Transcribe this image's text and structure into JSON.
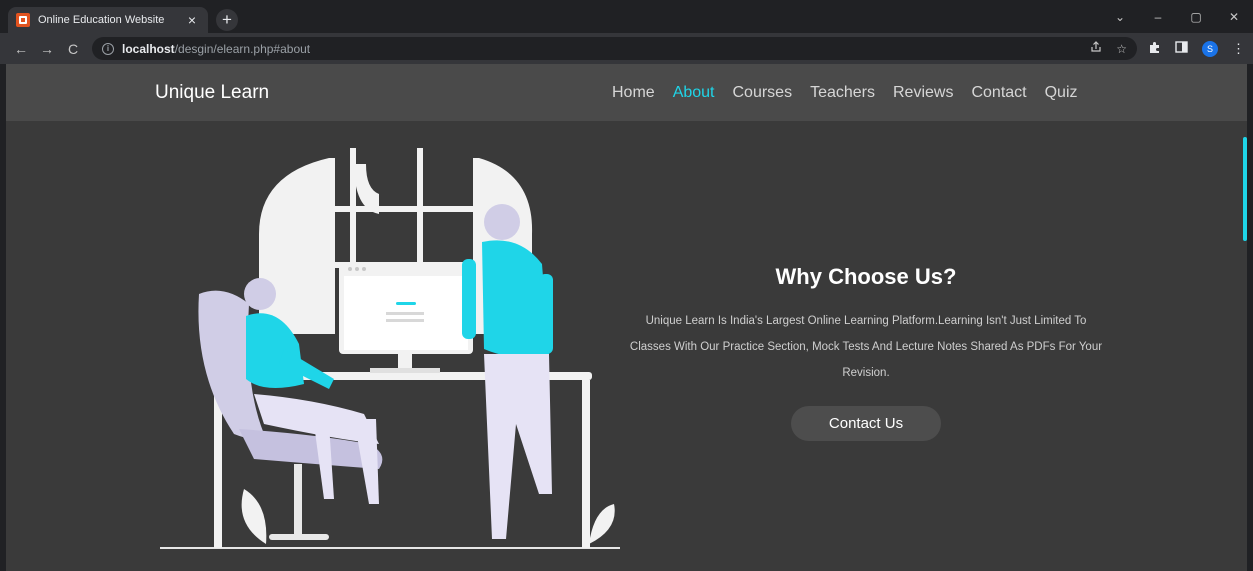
{
  "browser": {
    "tab_title": "Online Education Website",
    "tab_close": "×",
    "new_tab": "+",
    "url_host": "localhost",
    "url_path": "/desgin/elearn.php#about",
    "nav": {
      "back": "←",
      "forward": "→",
      "reload": "C"
    },
    "avatar_letter": "S",
    "window": {
      "chevron": "⌄",
      "minimize": "–",
      "maximize": "▢",
      "close": "✕"
    }
  },
  "site": {
    "logo": "Unique Learn",
    "nav": [
      {
        "label": "Home"
      },
      {
        "label": "About"
      },
      {
        "label": "Courses"
      },
      {
        "label": "Teachers"
      },
      {
        "label": "Reviews"
      },
      {
        "label": "Contact"
      },
      {
        "label": "Quiz"
      }
    ],
    "active_nav": "About",
    "about": {
      "title": "Why Choose Us?",
      "text": "Unique Learn Is India's Largest Online Learning Platform.Learning Isn't Just Limited To Classes With Our Practice Section, Mock Tests And Lecture Notes Shared As PDFs For Your Revision.",
      "button": "Contact Us"
    }
  },
  "colors": {
    "accent": "#1fd5e8",
    "header_bg": "#4a4a4a",
    "page_bg": "#3a3a3a"
  },
  "icons": [
    "tab-favicon-icon",
    "info-icon",
    "share-icon",
    "star-icon",
    "puzzle-icon",
    "sidepanel-icon",
    "menu-dots-icon"
  ]
}
